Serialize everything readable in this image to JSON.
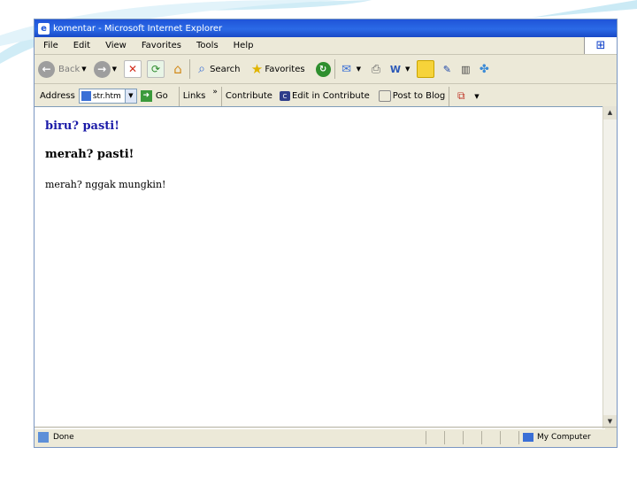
{
  "window": {
    "title": "komentar - Microsoft Internet Explorer"
  },
  "menu": [
    "File",
    "Edit",
    "View",
    "Favorites",
    "Tools",
    "Help"
  ],
  "toolbar": {
    "back_label": "Back",
    "search_label": "Search",
    "favorites_label": "Favorites"
  },
  "addressbar": {
    "label": "Address",
    "value": "str.htm",
    "go_label": "Go",
    "links_label": "Links",
    "links_more": "»",
    "contribute_label": "Contribute",
    "edit_in_contribute_label": "Edit in Contribute",
    "post_to_blog_label": "Post to Blog"
  },
  "content": {
    "line1": "biru? pasti!",
    "line2": "merah? pasti!",
    "line3": "merah? nggak mungkin!"
  },
  "status": {
    "text": "Done",
    "zone": "My Computer"
  },
  "colors": {
    "titlebar": "#2b6ae6",
    "line1_text": "#1b1ba8"
  }
}
